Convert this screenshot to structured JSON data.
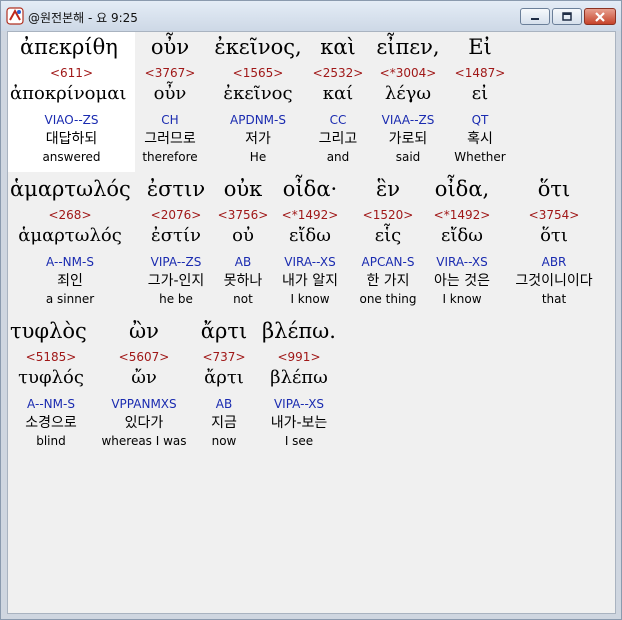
{
  "window": {
    "title": "@원전본해 - 요 9:25",
    "accent": "#c6432a"
  },
  "rows": [
    {
      "words": [
        {
          "greek": "ἀπεκρίθη",
          "strong": "<611>",
          "lemma": "ἀποκρίνομαι",
          "parse": "VIAO--ZS",
          "korean": "대답하되",
          "english": "answered",
          "selected": true
        },
        {
          "greek": "οὖν",
          "strong": "<3767>",
          "lemma": "οὖν",
          "parse": "CH",
          "korean": "그러므로",
          "english": "therefore"
        },
        {
          "greek": "ἐκεῖνος,",
          "strong": "<1565>",
          "lemma": "ἐκεῖνος",
          "parse": "APDNM-S",
          "korean": "저가",
          "english": "He"
        },
        {
          "greek": "καὶ",
          "strong": "<2532>",
          "lemma": "καί",
          "parse": "CC",
          "korean": "그리고",
          "english": "and"
        },
        {
          "greek": "εἶπεν,",
          "strong": "<*3004>",
          "lemma": "λέγω",
          "parse": "VIAA--ZS",
          "korean": "가로되",
          "english": "said"
        },
        {
          "greek": "Εἰ",
          "strong": "<1487>",
          "lemma": "εἰ",
          "parse": "QT",
          "korean": "혹시",
          "english": "Whether"
        }
      ]
    },
    {
      "words": [
        {
          "greek": "ἁμαρτωλός",
          "strong": "<268>",
          "lemma": "ἁμαρτωλός",
          "parse": "A--NM-S",
          "korean": "죄인",
          "english": "a sinner"
        },
        {
          "greek": "ἐστιν",
          "strong": "<2076>",
          "lemma": "ἐστίν",
          "parse": "VIPA--ZS",
          "korean": "그가-인지",
          "english": "he be"
        },
        {
          "greek": "οὐκ",
          "strong": "<3756>",
          "lemma": "οὐ",
          "parse": "AB",
          "korean": "못하나",
          "english": "not"
        },
        {
          "greek": "οἶδα·",
          "strong": "<*1492>",
          "lemma": "εἴδω",
          "parse": "VIRA--XS",
          "korean": "내가 알지",
          "english": "I know"
        },
        {
          "greek": "ἓν",
          "strong": "<1520>",
          "lemma": "εἷς",
          "parse": "APCAN-S",
          "korean": "한 가지",
          "english": "one thing"
        },
        {
          "greek": "οἶδα,",
          "strong": "<*1492>",
          "lemma": "εἴδω",
          "parse": "VIRA--XS",
          "korean": "아는 것은",
          "english": "I know"
        },
        {
          "greek": "ὅτι",
          "strong": "<3754>",
          "lemma": "ὅτι",
          "parse": "ABR",
          "korean": "그것이니이다",
          "english": "that"
        }
      ]
    },
    {
      "words": [
        {
          "greek": "τυφλὸς",
          "strong": "<5185>",
          "lemma": "τυφλός",
          "parse": "A--NM-S",
          "korean": "소경으로",
          "english": "blind"
        },
        {
          "greek": "ὢν",
          "strong": "<5607>",
          "lemma": "ὤν",
          "parse": "VPPANMXS",
          "korean": "있다가",
          "english": "whereas I was"
        },
        {
          "greek": "ἄρτι",
          "strong": "<737>",
          "lemma": "ἄρτι",
          "parse": "AB",
          "korean": "지금",
          "english": "now"
        },
        {
          "greek": "βλέπω.",
          "strong": "<991>",
          "lemma": "βλέπω",
          "parse": "VIPA--XS",
          "korean": "내가-보는",
          "english": "I see"
        }
      ]
    }
  ]
}
